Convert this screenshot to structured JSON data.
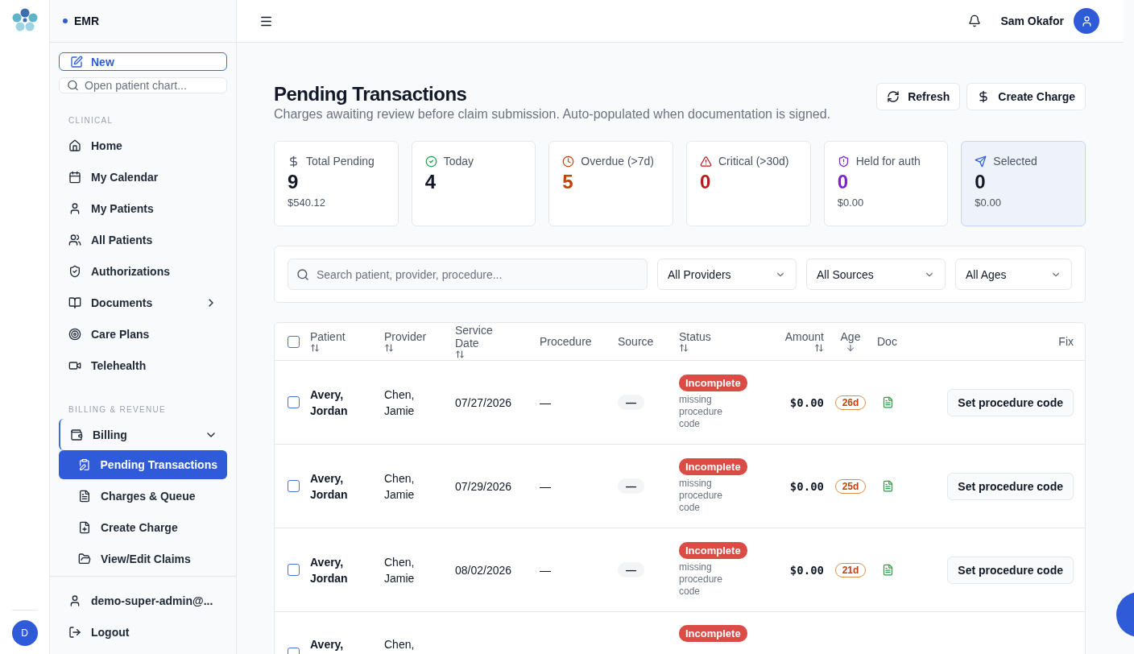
{
  "app": {
    "name": "EMR",
    "avatar": "D"
  },
  "sidebar": {
    "new_button": "New",
    "search": {
      "placeholder": "Open patient chart..."
    },
    "sections": [
      {
        "title": "CLINICAL",
        "items": [
          {
            "kind": "home",
            "label": "Home"
          },
          {
            "kind": "calendar",
            "label": "My Calendar"
          },
          {
            "kind": "user",
            "label": "My Patients"
          },
          {
            "kind": "users",
            "label": "All Patients"
          },
          {
            "kind": "shield",
            "label": "Authorizations"
          },
          {
            "kind": "book",
            "label": "Documents",
            "expanded": false
          },
          {
            "kind": "target",
            "label": "Care Plans"
          },
          {
            "kind": "video",
            "label": "Telehealth"
          }
        ]
      },
      {
        "title": "BILLING & REVENUE",
        "items": [
          {
            "kind": "wallet",
            "label": "Billing",
            "expanded": true,
            "children": [
              {
                "kind": "clipboard",
                "label": "Pending Transactions",
                "selected": true
              },
              {
                "kind": "list",
                "label": "Charges & Queue",
                "selected": false
              },
              {
                "kind": "fileplus",
                "label": "Create Charge",
                "selected": false
              },
              {
                "kind": "folder",
                "label": "View/Edit Claims",
                "selected": false
              }
            ]
          }
        ]
      }
    ],
    "footer": [
      {
        "kind": "user",
        "label": "demo-super-admin@..."
      },
      {
        "kind": "logout",
        "label": "Logout"
      }
    ]
  },
  "topbar": {
    "user": "Sam Okafor"
  },
  "page": {
    "title": "Pending Transactions",
    "subtitle": "Charges awaiting review before claim submission. Auto-populated when documentation is signed.",
    "actions": [
      {
        "kind": "refresh",
        "label": "Refresh"
      },
      {
        "kind": "dollar",
        "label": "Create Charge"
      }
    ]
  },
  "stats": [
    {
      "kind": "dollar",
      "label": "Total Pending",
      "value": "9",
      "sub": "$540.12",
      "color": "#111827",
      "selected": false
    },
    {
      "kind": "check",
      "label": "Today",
      "value": "4",
      "color": "#111827",
      "selected": false
    },
    {
      "kind": "clock",
      "label": "Overdue (>7d)",
      "value": "5",
      "color": "#c2410c",
      "selected": false
    },
    {
      "kind": "alert",
      "label": "Critical (>30d)",
      "value": "0",
      "color": "#b91c1c",
      "selected": false
    },
    {
      "kind": "shieldalert",
      "label": "Held for auth",
      "value": "0",
      "sub": "$0.00",
      "color": "#7e22ce",
      "selected": false
    },
    {
      "kind": "send",
      "label": "Selected",
      "value": "0",
      "sub": "$0.00",
      "color": "#111827",
      "selected": true
    }
  ],
  "filters": {
    "search": {
      "placeholder": "Search patient, provider, procedure..."
    },
    "selects": [
      "All Providers",
      "All Sources",
      "All Ages"
    ]
  },
  "table": {
    "all_checked": false,
    "columns": [
      {
        "label": "Patient",
        "kind": "sortable"
      },
      {
        "label": "Provider",
        "kind": "sortable"
      },
      {
        "label": "Service Date",
        "kind": "sortable"
      },
      {
        "label": "Procedure",
        "kind": "plain"
      },
      {
        "label": "Source",
        "kind": "plain"
      },
      {
        "label": "Status",
        "kind": "sortable"
      },
      {
        "label": "Amount",
        "kind": "sortable"
      },
      {
        "label": "Age",
        "kind": "sorted"
      },
      {
        "label": "Doc",
        "kind": "plain"
      },
      {
        "label": "Fix",
        "kind": "plain"
      }
    ],
    "rows": [
      {
        "checked": false,
        "patient": "Avery, Jordan",
        "provider": "Chen, Jamie",
        "date": "07/27/2026",
        "procedure": "—",
        "source": "—",
        "status": "Incomplete",
        "note": "missing procedure code",
        "amount": "$0.00",
        "age": "26d",
        "fix": "Set procedure code"
      },
      {
        "checked": false,
        "patient": "Avery, Jordan",
        "provider": "Chen, Jamie",
        "date": "07/29/2026",
        "procedure": "—",
        "source": "—",
        "status": "Incomplete",
        "note": "missing procedure code",
        "amount": "$0.00",
        "age": "25d",
        "fix": "Set procedure code"
      },
      {
        "checked": false,
        "patient": "Avery, Jordan",
        "provider": "Chen, Jamie",
        "date": "08/02/2026",
        "procedure": "—",
        "source": "—",
        "status": "Incomplete",
        "note": "missing procedure code",
        "amount": "$0.00",
        "age": "21d",
        "fix": "Set procedure code"
      },
      {
        "checked": false,
        "patient": "Avery,",
        "provider": "Chen,",
        "status": "Incomplete"
      }
    ]
  }
}
